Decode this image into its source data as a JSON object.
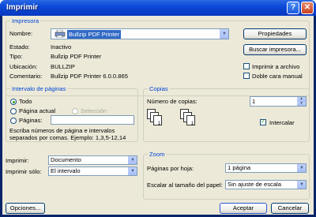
{
  "window": {
    "title": "Imprimir",
    "help_glyph": "?",
    "close_glyph": "✕"
  },
  "printer": {
    "group_title": "Impresora",
    "name_label": "Nombre:",
    "name_value": "Bullzip PDF Printer",
    "status_label": "Estado:",
    "status_value": "Inactivo",
    "type_label": "Tipo:",
    "type_value": "Bullzip PDF Printer",
    "location_label": "Ubicación:",
    "location_value": "BULLZIP",
    "comment_label": "Comentario:",
    "comment_value": "Bullzip PDF Printer 6.0.0.865",
    "properties_button": "Propiedades",
    "find_button": "Buscar impresora...",
    "print_to_file_label": "Imprimir a archivo",
    "print_to_file_checked": false,
    "duplex_label": "Doble cara manual",
    "duplex_checked": false
  },
  "page_range": {
    "group_title": "Intervalo de páginas",
    "all_label": "Todo",
    "current_label": "Página actual",
    "selection_label": "Selección",
    "pages_label": "Páginas:",
    "pages_value": "",
    "hint": "Escriba números de página e intervalos separados por comas. Ejemplo: 1,3,5-12,14",
    "selected": "all"
  },
  "copies": {
    "group_title": "Copias",
    "count_label": "Número de copias:",
    "count_value": "1",
    "collate_label": "Intercalar",
    "collate_checked": true
  },
  "print_what": {
    "print_label": "Imprimir:",
    "print_value": "Documento",
    "only_label": "Imprimir sólo:",
    "only_value": "El intervalo"
  },
  "zoom": {
    "group_title": "Zoom",
    "pages_per_sheet_label": "Páginas por hoja:",
    "pages_per_sheet_value": "1 página",
    "scale_label": "Escalar al tamaño del papel:",
    "scale_value": "Sin ajuste de escala"
  },
  "footer": {
    "options_button": "Opciones...",
    "ok_button": "Aceptar",
    "cancel_button": "Cancelar"
  }
}
